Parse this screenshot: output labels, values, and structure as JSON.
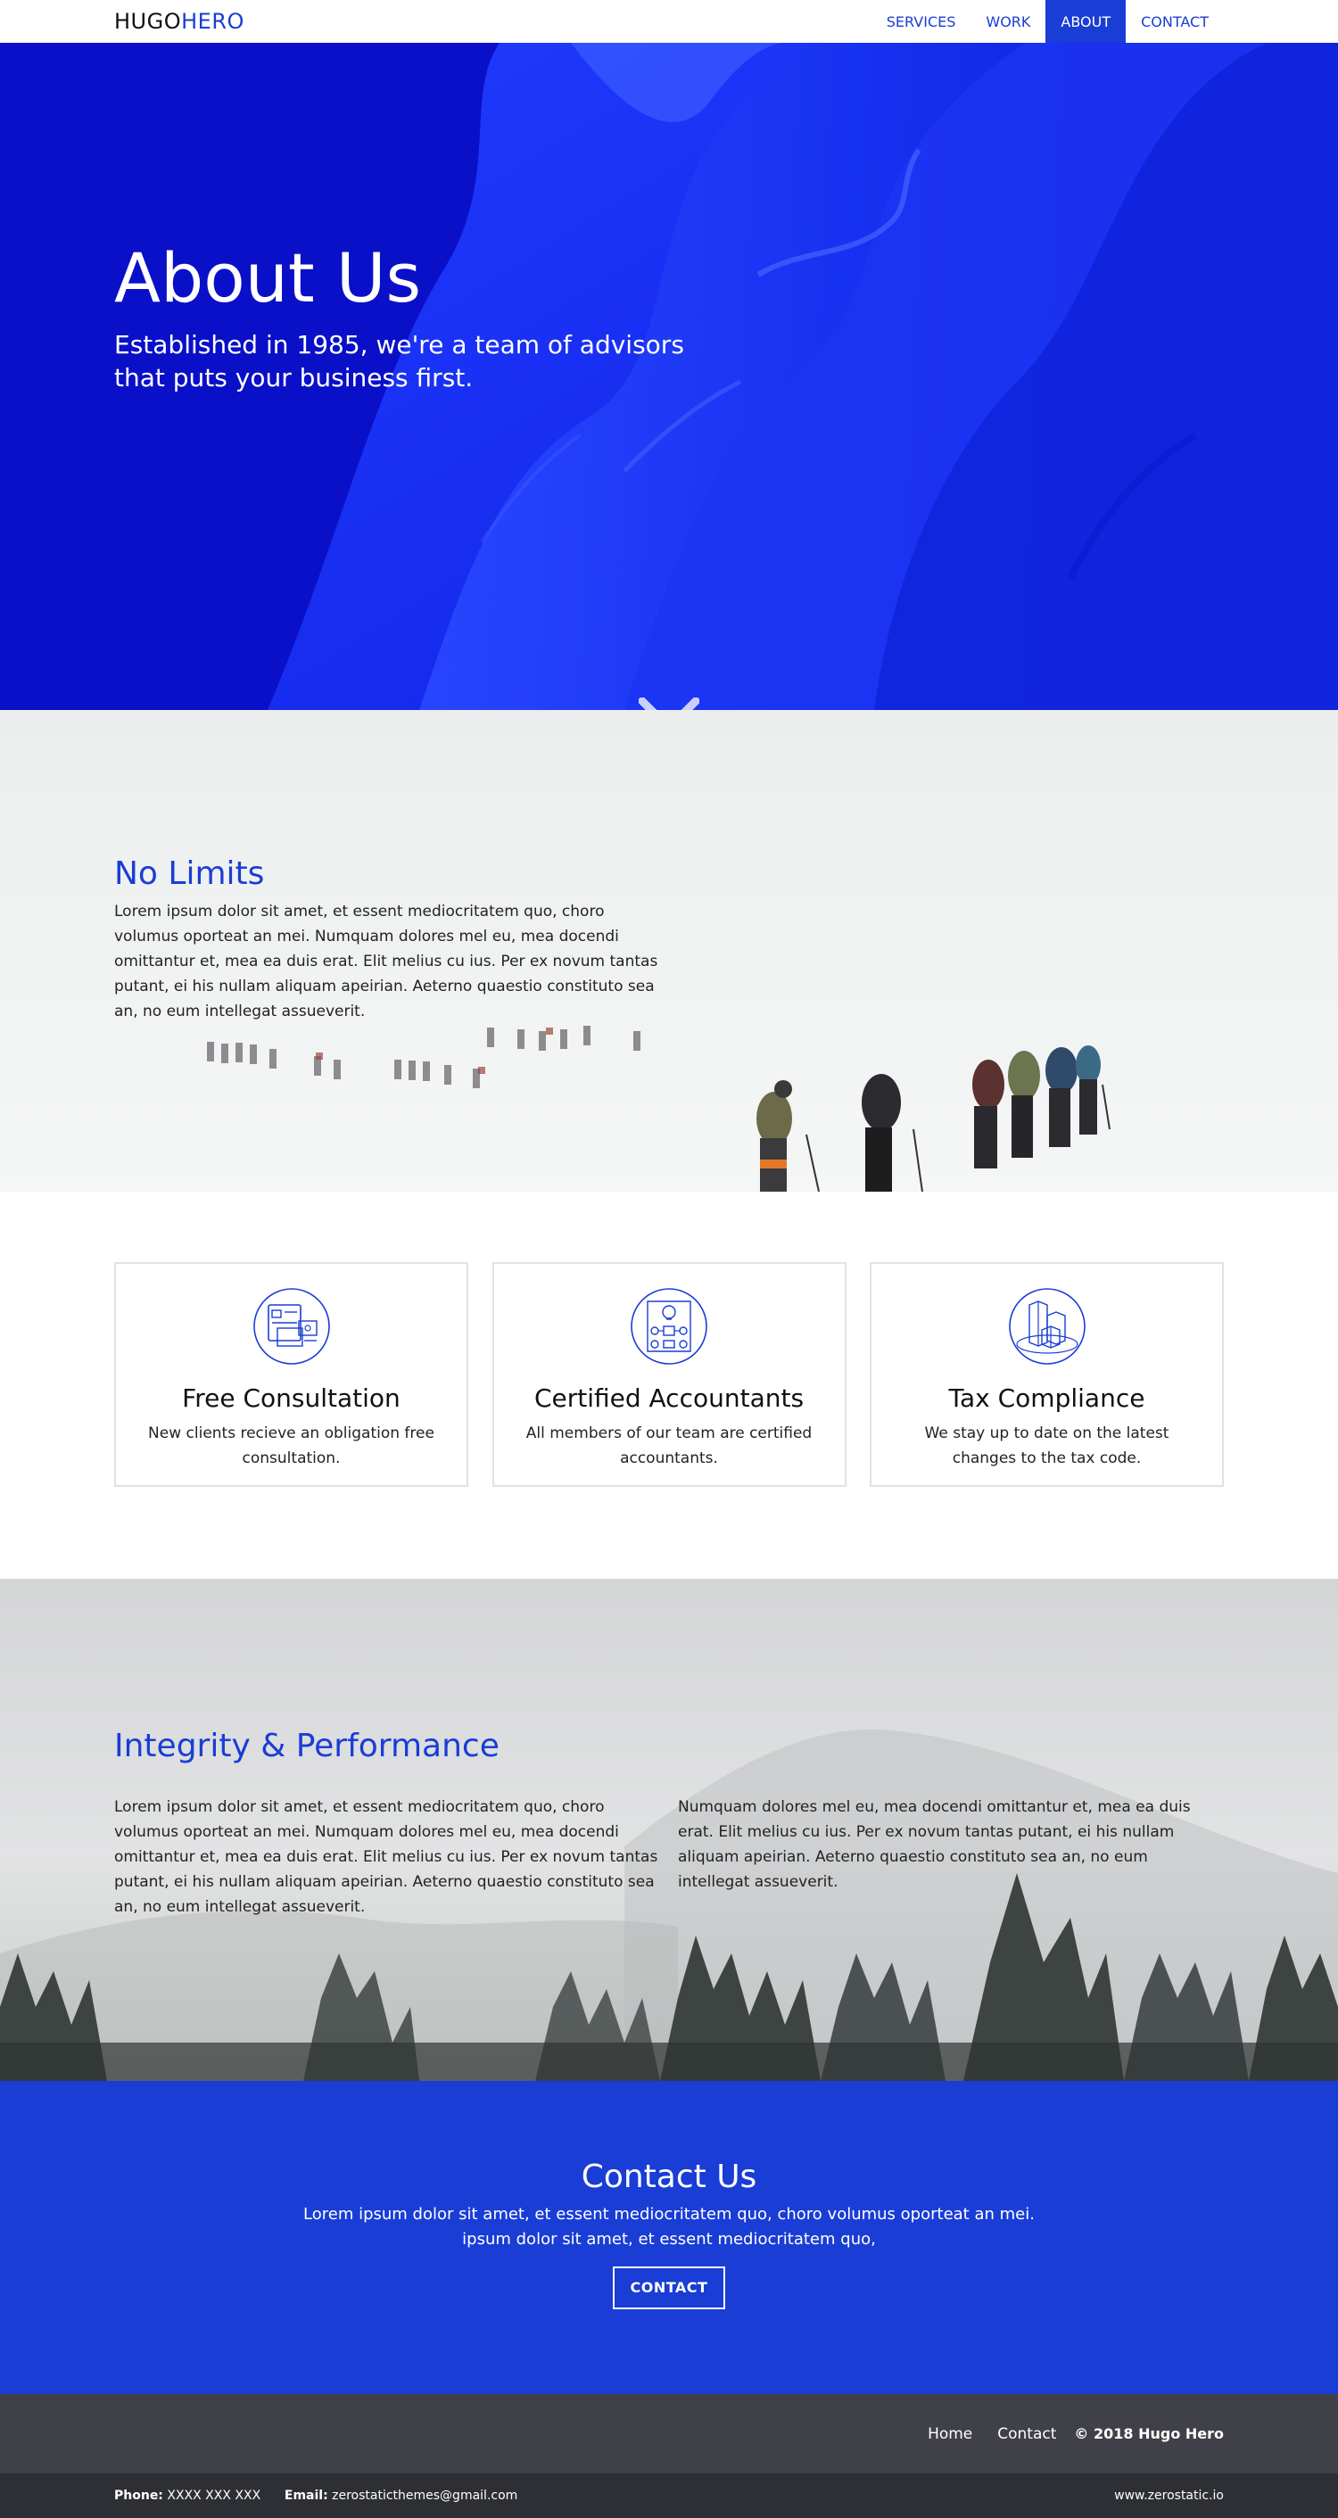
{
  "brand": {
    "part1": "HUGO",
    "part2": "HERO"
  },
  "nav": {
    "items": [
      {
        "label": "SERVICES"
      },
      {
        "label": "WORK"
      },
      {
        "label": "ABOUT",
        "active": true
      },
      {
        "label": "CONTACT"
      }
    ]
  },
  "hero": {
    "title": "About Us",
    "subtitle": "Established in 1985, we're a team of advisors that puts your business first."
  },
  "limits": {
    "title": "No Limits",
    "text": "Lorem ipsum dolor sit amet, et essent mediocritatem quo, choro volumus oporteat an mei. Numquam dolores mel eu, mea docendi omittantur et, mea ea duis erat. Elit melius cu ius. Per ex novum tantas putant, ei his nullam aliquam apeirian. Aeterno quaestio constituto sea an, no eum intellegat assueverit."
  },
  "features": [
    {
      "icon": "consultation-icon",
      "title": "Free Consultation",
      "text": "New clients recieve an obligation free consultation."
    },
    {
      "icon": "accountants-icon",
      "title": "Certified Accountants",
      "text": "All members of our team are certified accountants."
    },
    {
      "icon": "tax-compliance-icon",
      "title": "Tax Compliance",
      "text": "We stay up to date on the latest changes to the tax code."
    }
  ],
  "integrity": {
    "title": "Integrity & Performance",
    "col1": "Lorem ipsum dolor sit amet, et essent mediocritatem quo, choro volumus oporteat an mei. Numquam dolores mel eu, mea docendi omittantur et, mea ea duis erat. Elit melius cu ius. Per ex novum tantas putant, ei his nullam aliquam apeirian. Aeterno quaestio constituto sea an, no eum intellegat assueverit.",
    "col2": "Numquam dolores mel eu, mea docendi omittantur et, mea ea duis erat. Elit melius cu ius. Per ex novum tantas putant, ei his nullam aliquam apeirian. Aeterno quaestio constituto sea an, no eum intellegat assueverit."
  },
  "contact": {
    "title": "Contact Us",
    "text": "Lorem ipsum dolor sit amet, et essent mediocritatem quo, choro volumus oporteat an mei. ipsum dolor sit amet, et essent mediocritatem quo,",
    "button": "CONTACT"
  },
  "footer": {
    "links": [
      {
        "label": "Home"
      },
      {
        "label": "Contact"
      }
    ],
    "copyright": "© 2018 Hugo Hero",
    "phone_label": "Phone:",
    "phone": "XXXX XXX XXX",
    "email_label": "Email:",
    "email": "zerostaticthemes@gmail.com",
    "site": "www.zerostatic.io"
  },
  "colors": {
    "accent": "#1a3dd6",
    "hero_bg": "#0a10c8",
    "footer_top": "#404148",
    "footer_bottom": "#2e2f34"
  }
}
